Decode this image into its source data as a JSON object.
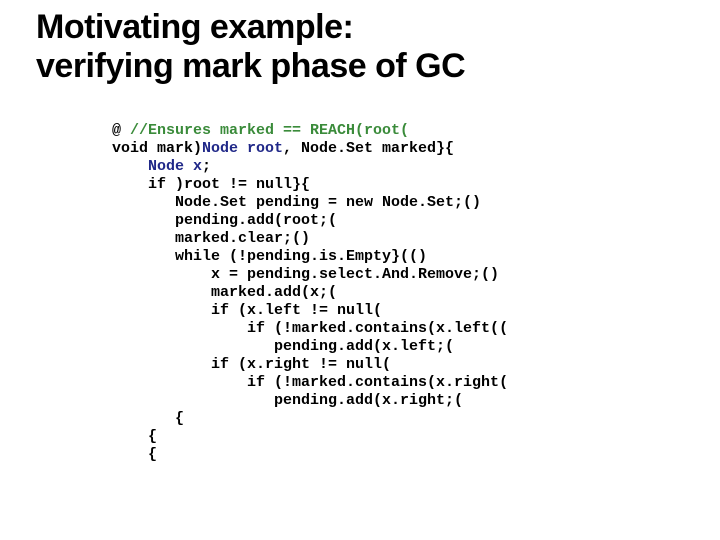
{
  "title_l1": "Motivating example:",
  "title_l2": "verifying mark phase of GC",
  "code": {
    "l01a": "@ ",
    "l01b": "//Ensures marked == REACH(root(",
    "l02a": "void mark)",
    "l02b": "Node root",
    "l02c": ", Node.Set marked}{",
    "l03a": "    ",
    "l03b": "Node x",
    "l03c": ";",
    "l04": "    if )root != null}{",
    "l05": "       Node.Set pending = new Node.Set;()",
    "l06": "       pending.add(root;(",
    "l07": "       marked.clear;()",
    "l08": "       while (!pending.is.Empty}(()",
    "l09": "           x = pending.select.And.Remove;()",
    "l10": "           marked.add(x;(",
    "l11": "           if (x.left != null(",
    "l12": "               if (!marked.contains(x.left((",
    "l13": "                  pending.add(x.left;(",
    "l14": "           if (x.right != null(",
    "l15": "               if (!marked.contains(x.right(",
    "l16": "                  pending.add(x.right;(",
    "l17": "       {",
    "l18": "    {",
    "l19": "    {"
  }
}
